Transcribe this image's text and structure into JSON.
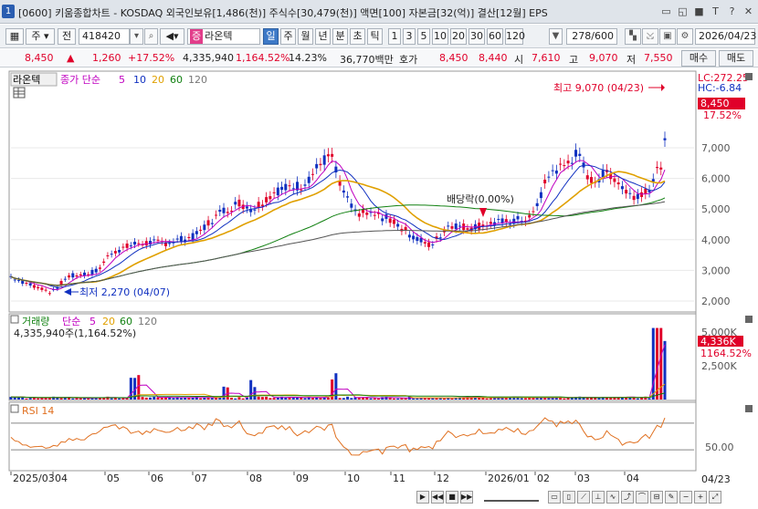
{
  "titlebar": {
    "window_number": "1",
    "title": "[0600] 키움종합차트 - KOSDAQ 외국인보유[1,486(천)] 주식수[30,479(천)] 액면[100] 자본금[32(억)] 결산[12월] EPS",
    "buttons": [
      "▭",
      "◱",
      "■",
      "T",
      "?",
      "✕"
    ]
  },
  "toolbar": {
    "market_type": "주",
    "prev_label": "전",
    "stock_code": "418420",
    "stock_tag": "증",
    "stock_name": "라온텍",
    "periods": [
      "일",
      "주",
      "월",
      "년",
      "분",
      "초",
      "틱"
    ],
    "active_period": "일",
    "intervals": [
      "1",
      "3",
      "5",
      "10",
      "20",
      "30",
      "60",
      "120"
    ],
    "page_count": "278/600",
    "date": "2026/04/23"
  },
  "quote": {
    "price": "8,450",
    "change_arrow": "▲",
    "change": "1,260",
    "change_pct": "+17.52%",
    "volume": "4,335,940",
    "volume_ratio": "1,164.52%",
    "turnover": "14.23%",
    "amount": "36,770백만",
    "bid_label": "호가",
    "ask_price": "8,450",
    "bid_price": "8,440",
    "open_label": "시",
    "open": "7,610",
    "high_label": "고",
    "high": "9,070",
    "low_label": "저",
    "low": "7,550",
    "buy_button": "매수",
    "sell_button": "매도"
  },
  "price_panel": {
    "stock_label": "라온텍",
    "ma_label": "종가 단순",
    "ma_periods": [
      "5",
      "10",
      "20",
      "60",
      "120"
    ],
    "ma_colors": [
      "#c000c0",
      "#1030c0",
      "#e0a000",
      "#108010",
      "#555555"
    ],
    "lc": "LC:272.25",
    "hc": "HC:-6.84",
    "last_price": "8,450",
    "last_pct": "17.52%",
    "high_annotation": "최고 9,070 (04/23)",
    "low_annotation": "최저 2,270 (04/07)",
    "dividend_annotation": "배당락(0.00%)",
    "y_ticks": [
      "7,000",
      "6,000",
      "5,000",
      "4,000",
      "3,000",
      "2,000"
    ]
  },
  "volume_panel": {
    "label": "거래량",
    "ma_label": "단순",
    "ma_periods": [
      "5",
      "20",
      "60",
      "120"
    ],
    "ma_colors": [
      "#c000c0",
      "#e0a000",
      "#108010",
      "#555555"
    ],
    "value": "4,335,940주(1,164.52%)",
    "last_value": "4,336K",
    "last_pct": "1164.52%",
    "y_ticks": [
      "5,000K",
      "2,500K"
    ]
  },
  "rsi_panel": {
    "label": "RSI 14",
    "y_tick": "50.00"
  },
  "x_axis": {
    "labels": [
      "2025/03",
      "04",
      "05",
      "06",
      "07",
      "08",
      "09",
      "10",
      "11",
      "12",
      "2026/01",
      "02",
      "03",
      "04"
    ],
    "cursor_label": "04/23"
  },
  "colors": {
    "up": "#e0002a",
    "down": "#1030c0",
    "rsi": "#e07020",
    "active": "#3d79c7"
  }
}
